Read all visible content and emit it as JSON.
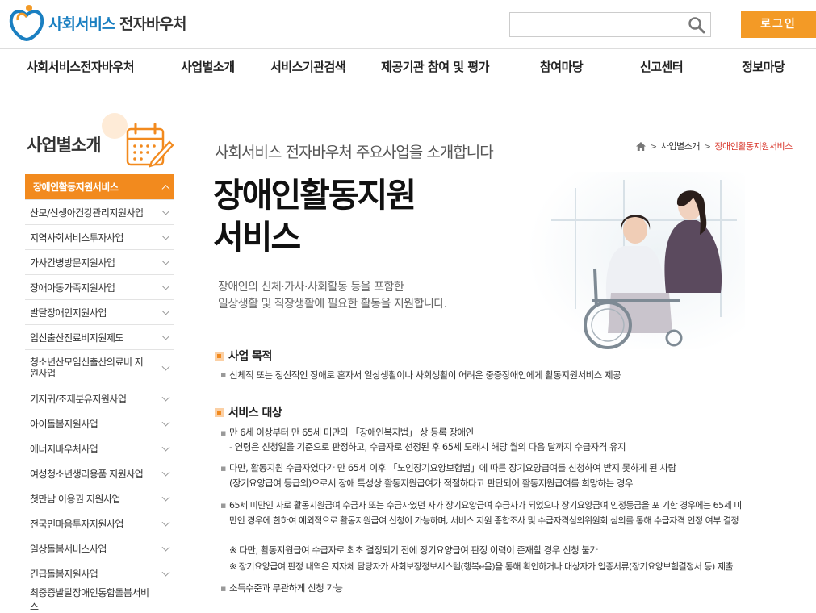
{
  "header": {
    "logo_part1": "사회서비스",
    "logo_part2": "전자바우처",
    "search_placeholder": "",
    "login_label": "로그인"
  },
  "gnb": [
    "사회서비스전자바우처",
    "사업별소개",
    "서비스기관검색",
    "제공기관 참여 및 평가",
    "참여마당",
    "신고센터",
    "정보마당"
  ],
  "sidebar": {
    "title": "사업별소개",
    "items": [
      "장애인활동지원서비스",
      "산모/신생아건강관리지원사업",
      "지역사회서비스투자사업",
      "가사간병방문지원사업",
      "장애아동가족지원사업",
      "발달장애인지원사업",
      "임신출산진료비지원제도",
      "청소년산모임신출산의료비 지원사업",
      "기저귀/조제분유지원사업",
      "아이돌봄지원사업",
      "에너지바우처사업",
      "여성청소년생리용품 지원사업",
      "첫만남 이용권 지원사업",
      "전국민마음투자지원사업",
      "일상돌봄서비스사업",
      "긴급돌봄지원사업",
      "최중증발달장애인통합돌봄서비스"
    ]
  },
  "breadcrumb": {
    "level1": "사업별소개",
    "current": "장애인활동지원서비스"
  },
  "main": {
    "intro": "사회서비스 전자바우처 주요사업을 소개합니다",
    "title_line1": "장애인활동지원",
    "title_line2": "서비스",
    "desc_line1": "장애인의 신체·가사·사회활동 등을 포함한",
    "desc_line2": "일상생활 및 직장생활에 필요한 활동을 지원합니다.",
    "section1_title": "사업 목적",
    "section1_text": "신체적 또는 정신적인 장애로 혼자서 일상생활이나 사회생활이 어려운 중증장애인에게 활동지원서비스 제공",
    "section2_title": "서비스 대상",
    "t1": "만 6세 이상부터 만 65세 미만의 「장애인복지법」 상 등록 장애인",
    "t1b": "- 연령은 신청일을 기준으로 판정하고, 수급자로 선정된 후 65세 도래시 해당 월의 다음 달까지 수급자격 유지",
    "t2": "다만, 활동지원 수급자였다가 만 65세 이후 「노인장기요양보험법」에 따른 장기요양급여를 신청하여 받지 못하게 된 사람",
    "t2b": "(장기요양급여 등급외)으로서 장애 특성상 활동지원급여가 적절하다고 판단되어 활동지원급여를 희망하는 경우",
    "t3": "65세 미만인 자로 활동지원급여 수급자 또는 수급자였던 자가 장기요양급여 수급자가 되었으나 장기요양급여 인정등급을 포 기한 경우에는 65세 미",
    "t3b": "만인 경우에 한하여 예외적으로 활동지원급여 신청이 가능하며, 서비스 지원 종합조사 및 수급자격심의위원회 심의를 통해 수급자격 인정 여부 결정",
    "note1": "※ 다만, 활동지원급여 수급자로 최초 결정되기 전에 장기요양급여 판정 이력이 존재할 경우 신청 불가",
    "note2": "※ 장기요양급여 판정 내역은 지자체 담당자가 사회보장정보시스템(행복e음)을 통해 확인하거나 대상자가 입증서류(장기요양보험결정서 등) 제출",
    "t4": "소득수준과 무관하게 신청 가능"
  },
  "colors": {
    "brand_blue": "#1a7fc1",
    "accent_orange": "#f28a1e",
    "login_orange": "#f39a26",
    "breadcrumb_current": "#d8352a"
  }
}
